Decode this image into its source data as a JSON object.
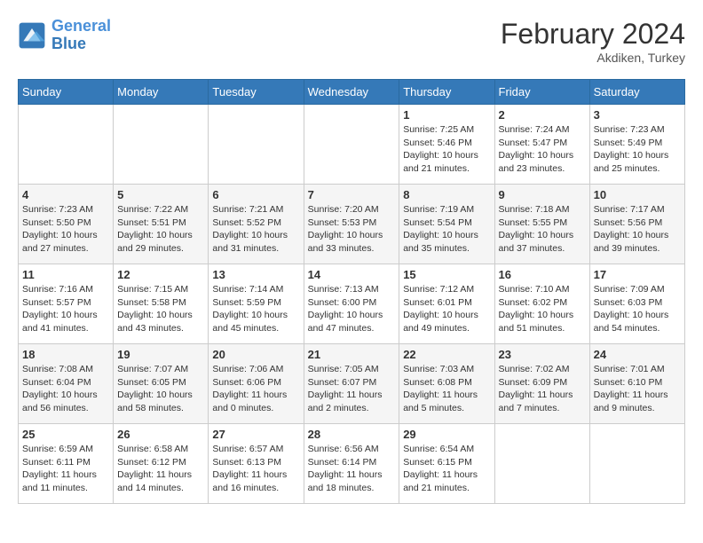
{
  "header": {
    "logo_line1": "General",
    "logo_line2": "Blue",
    "month_title": "February 2024",
    "location": "Akdiken, Turkey"
  },
  "weekdays": [
    "Sunday",
    "Monday",
    "Tuesday",
    "Wednesday",
    "Thursday",
    "Friday",
    "Saturday"
  ],
  "weeks": [
    [
      {
        "day": "",
        "content": ""
      },
      {
        "day": "",
        "content": ""
      },
      {
        "day": "",
        "content": ""
      },
      {
        "day": "",
        "content": ""
      },
      {
        "day": "1",
        "content": "Sunrise: 7:25 AM\nSunset: 5:46 PM\nDaylight: 10 hours\nand 21 minutes."
      },
      {
        "day": "2",
        "content": "Sunrise: 7:24 AM\nSunset: 5:47 PM\nDaylight: 10 hours\nand 23 minutes."
      },
      {
        "day": "3",
        "content": "Sunrise: 7:23 AM\nSunset: 5:49 PM\nDaylight: 10 hours\nand 25 minutes."
      }
    ],
    [
      {
        "day": "4",
        "content": "Sunrise: 7:23 AM\nSunset: 5:50 PM\nDaylight: 10 hours\nand 27 minutes."
      },
      {
        "day": "5",
        "content": "Sunrise: 7:22 AM\nSunset: 5:51 PM\nDaylight: 10 hours\nand 29 minutes."
      },
      {
        "day": "6",
        "content": "Sunrise: 7:21 AM\nSunset: 5:52 PM\nDaylight: 10 hours\nand 31 minutes."
      },
      {
        "day": "7",
        "content": "Sunrise: 7:20 AM\nSunset: 5:53 PM\nDaylight: 10 hours\nand 33 minutes."
      },
      {
        "day": "8",
        "content": "Sunrise: 7:19 AM\nSunset: 5:54 PM\nDaylight: 10 hours\nand 35 minutes."
      },
      {
        "day": "9",
        "content": "Sunrise: 7:18 AM\nSunset: 5:55 PM\nDaylight: 10 hours\nand 37 minutes."
      },
      {
        "day": "10",
        "content": "Sunrise: 7:17 AM\nSunset: 5:56 PM\nDaylight: 10 hours\nand 39 minutes."
      }
    ],
    [
      {
        "day": "11",
        "content": "Sunrise: 7:16 AM\nSunset: 5:57 PM\nDaylight: 10 hours\nand 41 minutes."
      },
      {
        "day": "12",
        "content": "Sunrise: 7:15 AM\nSunset: 5:58 PM\nDaylight: 10 hours\nand 43 minutes."
      },
      {
        "day": "13",
        "content": "Sunrise: 7:14 AM\nSunset: 5:59 PM\nDaylight: 10 hours\nand 45 minutes."
      },
      {
        "day": "14",
        "content": "Sunrise: 7:13 AM\nSunset: 6:00 PM\nDaylight: 10 hours\nand 47 minutes."
      },
      {
        "day": "15",
        "content": "Sunrise: 7:12 AM\nSunset: 6:01 PM\nDaylight: 10 hours\nand 49 minutes."
      },
      {
        "day": "16",
        "content": "Sunrise: 7:10 AM\nSunset: 6:02 PM\nDaylight: 10 hours\nand 51 minutes."
      },
      {
        "day": "17",
        "content": "Sunrise: 7:09 AM\nSunset: 6:03 PM\nDaylight: 10 hours\nand 54 minutes."
      }
    ],
    [
      {
        "day": "18",
        "content": "Sunrise: 7:08 AM\nSunset: 6:04 PM\nDaylight: 10 hours\nand 56 minutes."
      },
      {
        "day": "19",
        "content": "Sunrise: 7:07 AM\nSunset: 6:05 PM\nDaylight: 10 hours\nand 58 minutes."
      },
      {
        "day": "20",
        "content": "Sunrise: 7:06 AM\nSunset: 6:06 PM\nDaylight: 11 hours\nand 0 minutes."
      },
      {
        "day": "21",
        "content": "Sunrise: 7:05 AM\nSunset: 6:07 PM\nDaylight: 11 hours\nand 2 minutes."
      },
      {
        "day": "22",
        "content": "Sunrise: 7:03 AM\nSunset: 6:08 PM\nDaylight: 11 hours\nand 5 minutes."
      },
      {
        "day": "23",
        "content": "Sunrise: 7:02 AM\nSunset: 6:09 PM\nDaylight: 11 hours\nand 7 minutes."
      },
      {
        "day": "24",
        "content": "Sunrise: 7:01 AM\nSunset: 6:10 PM\nDaylight: 11 hours\nand 9 minutes."
      }
    ],
    [
      {
        "day": "25",
        "content": "Sunrise: 6:59 AM\nSunset: 6:11 PM\nDaylight: 11 hours\nand 11 minutes."
      },
      {
        "day": "26",
        "content": "Sunrise: 6:58 AM\nSunset: 6:12 PM\nDaylight: 11 hours\nand 14 minutes."
      },
      {
        "day": "27",
        "content": "Sunrise: 6:57 AM\nSunset: 6:13 PM\nDaylight: 11 hours\nand 16 minutes."
      },
      {
        "day": "28",
        "content": "Sunrise: 6:56 AM\nSunset: 6:14 PM\nDaylight: 11 hours\nand 18 minutes."
      },
      {
        "day": "29",
        "content": "Sunrise: 6:54 AM\nSunset: 6:15 PM\nDaylight: 11 hours\nand 21 minutes."
      },
      {
        "day": "",
        "content": ""
      },
      {
        "day": "",
        "content": ""
      }
    ]
  ]
}
